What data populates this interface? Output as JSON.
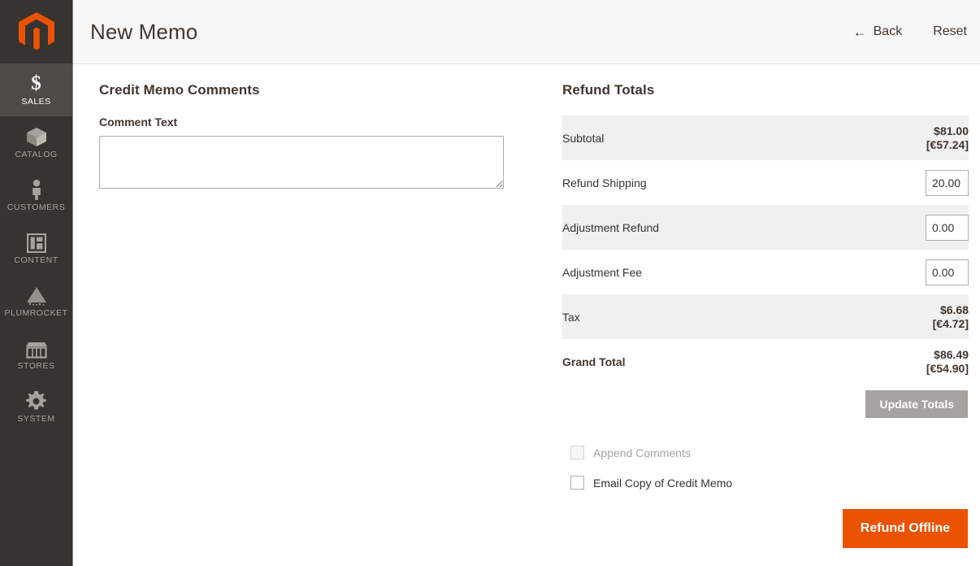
{
  "sidebar": {
    "logo": "magento-logo",
    "items": [
      {
        "label": "SALES",
        "icon": "dollar-icon",
        "active": true
      },
      {
        "label": "CATALOG",
        "icon": "box-icon",
        "active": false
      },
      {
        "label": "CUSTOMERS",
        "icon": "person-icon",
        "active": false
      },
      {
        "label": "CONTENT",
        "icon": "layout-icon",
        "active": false
      },
      {
        "label": "PLUMROCKET",
        "icon": "rocket-icon",
        "active": false
      },
      {
        "label": "STORES",
        "icon": "storefront-icon",
        "active": false
      },
      {
        "label": "SYSTEM",
        "icon": "gear-icon",
        "active": false
      }
    ]
  },
  "header": {
    "title": "New Memo",
    "back_label": "Back",
    "back_arrow": "←",
    "reset_label": "Reset"
  },
  "comments": {
    "section_title": "Credit Memo Comments",
    "field_label": "Comment Text",
    "value": "",
    "placeholder": ""
  },
  "totals": {
    "section_title": "Refund Totals",
    "rows": [
      {
        "label": "Subtotal",
        "type": "value",
        "base": "$81.00",
        "alt": "[€57.24]",
        "bold": false,
        "shaded": true
      },
      {
        "label": "Refund Shipping",
        "type": "input",
        "value": "20.00",
        "bold": false,
        "shaded": false
      },
      {
        "label": "Adjustment Refund",
        "type": "input",
        "value": "0.00",
        "bold": false,
        "shaded": true
      },
      {
        "label": "Adjustment Fee",
        "type": "input",
        "value": "0.00",
        "bold": false,
        "shaded": false
      },
      {
        "label": "Tax",
        "type": "value",
        "base": "$6.68",
        "alt": "[€4.72]",
        "bold": false,
        "shaded": true
      },
      {
        "label": "Grand Total",
        "type": "value",
        "base": "$86.49",
        "alt": "[€54.90]",
        "bold": true,
        "shaded": false
      }
    ],
    "update_label": "Update Totals",
    "update_disabled": true
  },
  "options": {
    "append_comments": {
      "label": "Append Comments",
      "checked": false,
      "disabled": true
    },
    "email_copy": {
      "label": "Email Copy of Credit Memo",
      "checked": false,
      "disabled": false
    }
  },
  "submit": {
    "refund_label": "Refund Offline"
  },
  "colors": {
    "accent_orange": "#eb5202",
    "sidebar_bg": "#373330",
    "sidebar_active": "#504a46",
    "row_shade": "#f0f0f0",
    "header_bg": "#f8f8f8",
    "disabled_gray": "#a6a29f"
  }
}
